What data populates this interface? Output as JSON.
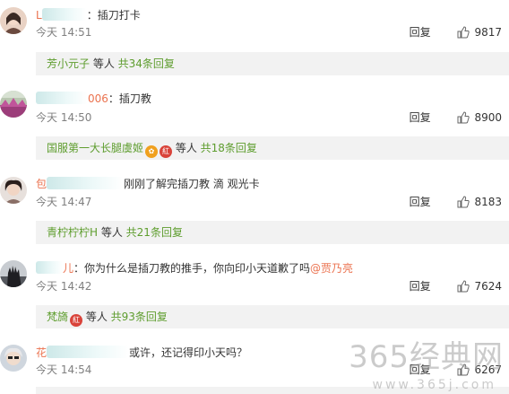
{
  "comments": [
    {
      "name_tail": "",
      "text": "：插刀打卡",
      "time": "今天 14:51",
      "reply": "回复",
      "likes": "9817",
      "sub": {
        "name": "芳小元子",
        "mid": " 等人 ",
        "count": "共34条回复"
      }
    },
    {
      "name_tail": "006",
      "text": "：插刀教",
      "time": "今天 14:50",
      "reply": "回复",
      "likes": "8900",
      "sub": {
        "name": "国服第一大长腿虞姬",
        "mid": " 等人 ",
        "count": "共18条回复"
      }
    },
    {
      "name_tail": "",
      "text": "刚刚了解完插刀教 滴 观光卡",
      "time": "今天 14:47",
      "reply": "回复",
      "likes": "8183",
      "sub": {
        "name": "青柠柠柠H",
        "mid": " 等人 ",
        "count": "共21条回复"
      }
    },
    {
      "name_tail": "儿",
      "text": "：你为什么是插刀教的推手，你向印小天道歉了吗",
      "mention": "@贾乃亮",
      "time": "今天 14:42",
      "reply": "回复",
      "likes": "7624",
      "sub": {
        "name": "梵旖",
        "mid": " 等人 ",
        "count": "共93条回复"
      }
    },
    {
      "name_tail": "",
      "text": "或许，还记得印小天吗？",
      "time": "今天 14:54",
      "reply": "回复",
      "likes": "6267"
    }
  ],
  "watermark": {
    "text": "365经典网",
    "url": "www.365j.com"
  }
}
